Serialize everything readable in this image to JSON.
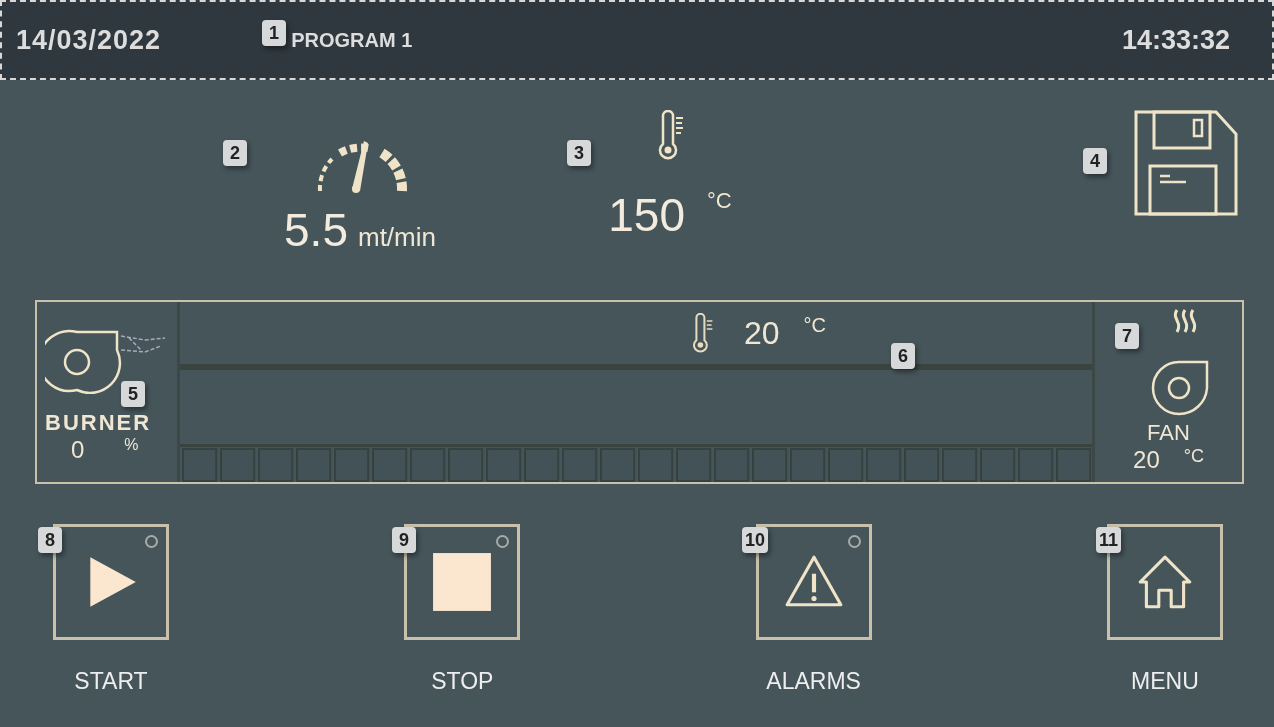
{
  "header": {
    "date": "14/03/2022",
    "program": "PROGRAM 1",
    "time": "14:33:32"
  },
  "speed": {
    "value": "5.5",
    "unit": "mt/min"
  },
  "temperature": {
    "value": "150",
    "unit": "°C"
  },
  "burner": {
    "label": "BURNER",
    "value": "0",
    "unit": "%"
  },
  "oven": {
    "temperature": "20",
    "unit": "°C"
  },
  "fan": {
    "label": "FAN",
    "value": "20",
    "unit": "°C"
  },
  "buttons": [
    {
      "kind": "start",
      "label": "START"
    },
    {
      "kind": "stop",
      "label": "STOP"
    },
    {
      "kind": "alarms",
      "label": "ALARMS"
    },
    {
      "kind": "menu",
      "label": "MENU"
    }
  ],
  "callouts": [
    "1",
    "2",
    "3",
    "4",
    "5",
    "6",
    "7",
    "8",
    "9",
    "10",
    "11"
  ]
}
